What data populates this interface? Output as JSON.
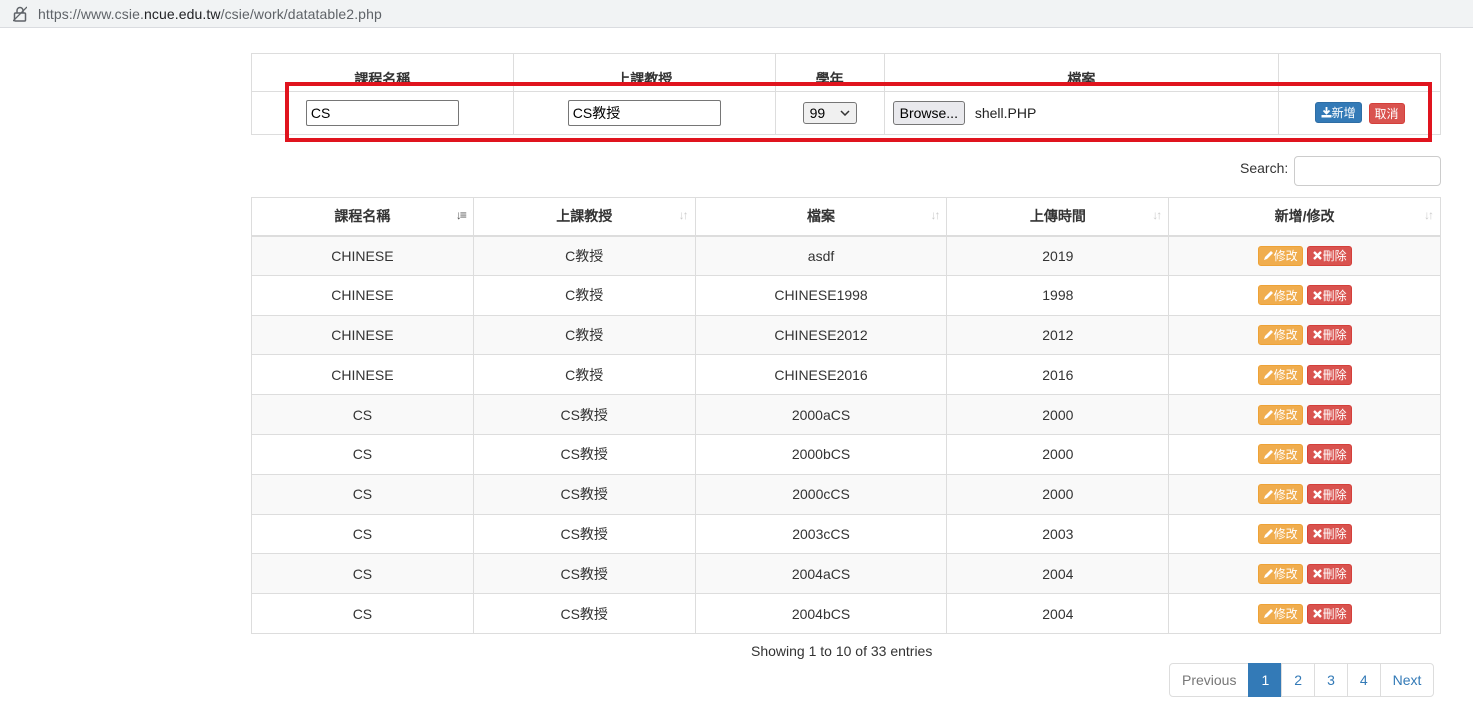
{
  "browser": {
    "url_prefix": "https://www.csie.",
    "url_domain": "ncue.edu.tw",
    "url_path": "/csie/work/datatable2.php"
  },
  "form": {
    "headers": [
      "課程名稱",
      "上課教授",
      "學年",
      "檔案",
      ""
    ],
    "course_value": "CS",
    "professor_value": "CS教授",
    "year_selected": "99",
    "browse_label": "Browse...",
    "file_name": "shell.PHP",
    "add_label": "新增",
    "cancel_label": "取消"
  },
  "search": {
    "label": "Search:"
  },
  "table": {
    "headers": [
      "課程名稱",
      "上課教授",
      "檔案",
      "上傳時間",
      "新增/修改"
    ],
    "edit_label": "修改",
    "delete_label": "刪除",
    "rows": [
      [
        "CHINESE",
        "C教授",
        "asdf",
        "2019"
      ],
      [
        "CHINESE",
        "C教授",
        "CHINESE1998",
        "1998"
      ],
      [
        "CHINESE",
        "C教授",
        "CHINESE2012",
        "2012"
      ],
      [
        "CHINESE",
        "C教授",
        "CHINESE2016",
        "2016"
      ],
      [
        "CS",
        "CS教授",
        "2000aCS",
        "2000"
      ],
      [
        "CS",
        "CS教授",
        "2000bCS",
        "2000"
      ],
      [
        "CS",
        "CS教授",
        "2000cCS",
        "2000"
      ],
      [
        "CS",
        "CS教授",
        "2003cCS",
        "2003"
      ],
      [
        "CS",
        "CS教授",
        "2004aCS",
        "2004"
      ],
      [
        "CS",
        "CS教授",
        "2004bCS",
        "2004"
      ]
    ]
  },
  "info": "Showing 1 to 10 of 33 entries",
  "pagination": {
    "previous": "Previous",
    "pages": [
      "1",
      "2",
      "3",
      "4"
    ],
    "active_page": "1",
    "next": "Next"
  },
  "colors": {
    "primary": "#337ab7",
    "danger": "#d9534f",
    "warning": "#f0ad4e",
    "highlight": "#e0141e"
  }
}
